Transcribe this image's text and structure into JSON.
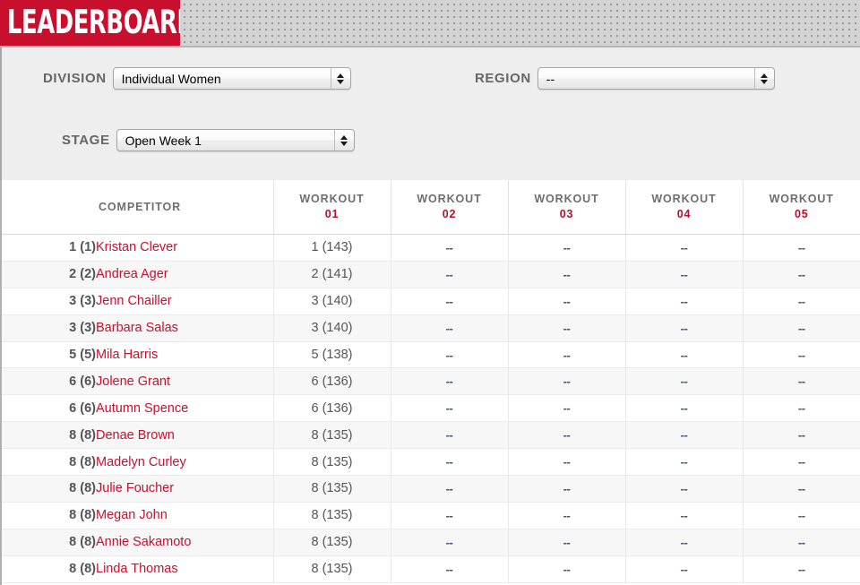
{
  "banner": {
    "title": "LEADERBOARD",
    "brand_color": "#c8102e"
  },
  "filters": {
    "division": {
      "label": "DIVISION",
      "value": "Individual Women",
      "icon": "stepper-arrows-icon"
    },
    "region": {
      "label": "REGION",
      "value": "--",
      "icon": "stepper-arrows-icon"
    },
    "stage": {
      "label": "STAGE",
      "value": "Open Week 1",
      "icon": "stepper-arrows-icon"
    }
  },
  "table": {
    "headers": {
      "rank": "",
      "competitor": "COMPETITOR",
      "workouts": [
        {
          "label": "WORKOUT",
          "num": "01"
        },
        {
          "label": "WORKOUT",
          "num": "02"
        },
        {
          "label": "WORKOUT",
          "num": "03"
        },
        {
          "label": "WORKOUT",
          "num": "04"
        },
        {
          "label": "WORKOUT",
          "num": "05"
        }
      ]
    },
    "empty_value": "--",
    "rows": [
      {
        "rank": "1 (1)",
        "name": "Kristan Clever",
        "w1": "1 (143)",
        "w2": "--",
        "w3": "--",
        "w4": "--",
        "w5": "--"
      },
      {
        "rank": "2 (2)",
        "name": "Andrea Ager",
        "w1": "2 (141)",
        "w2": "--",
        "w3": "--",
        "w4": "--",
        "w5": "--"
      },
      {
        "rank": "3 (3)",
        "name": "Jenn Chailler",
        "w1": "3 (140)",
        "w2": "--",
        "w3": "--",
        "w4": "--",
        "w5": "--"
      },
      {
        "rank": "3 (3)",
        "name": "Barbara Salas",
        "w1": "3 (140)",
        "w2": "--",
        "w3": "--",
        "w4": "--",
        "w5": "--"
      },
      {
        "rank": "5 (5)",
        "name": "Mila Harris",
        "w1": "5 (138)",
        "w2": "--",
        "w3": "--",
        "w4": "--",
        "w5": "--"
      },
      {
        "rank": "6 (6)",
        "name": "Jolene Grant",
        "w1": "6 (136)",
        "w2": "--",
        "w3": "--",
        "w4": "--",
        "w5": "--"
      },
      {
        "rank": "6 (6)",
        "name": "Autumn Spence",
        "w1": "6 (136)",
        "w2": "--",
        "w3": "--",
        "w4": "--",
        "w5": "--"
      },
      {
        "rank": "8 (8)",
        "name": "Denae Brown",
        "w1": "8 (135)",
        "w2": "--",
        "w3": "--",
        "w4": "--",
        "w5": "--"
      },
      {
        "rank": "8 (8)",
        "name": "Madelyn Curley",
        "w1": "8 (135)",
        "w2": "--",
        "w3": "--",
        "w4": "--",
        "w5": "--"
      },
      {
        "rank": "8 (8)",
        "name": "Julie Foucher",
        "w1": "8 (135)",
        "w2": "--",
        "w3": "--",
        "w4": "--",
        "w5": "--"
      },
      {
        "rank": "8 (8)",
        "name": "Megan John",
        "w1": "8 (135)",
        "w2": "--",
        "w3": "--",
        "w4": "--",
        "w5": "--"
      },
      {
        "rank": "8 (8)",
        "name": "Annie Sakamoto",
        "w1": "8 (135)",
        "w2": "--",
        "w3": "--",
        "w4": "--",
        "w5": "--"
      },
      {
        "rank": "8 (8)",
        "name": "Linda Thomas",
        "w1": "8 (135)",
        "w2": "--",
        "w3": "--",
        "w4": "--",
        "w5": "--"
      }
    ]
  }
}
